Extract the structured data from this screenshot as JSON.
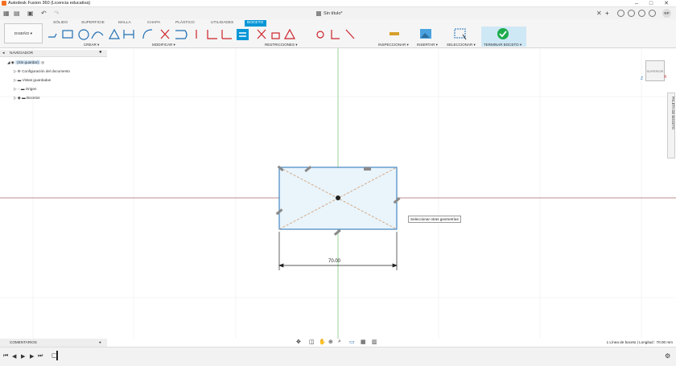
{
  "window": {
    "title": "Autodesk Fusion 360 (Licencia educativa)",
    "minimize": "–",
    "maximize": "□",
    "close": "✕"
  },
  "document": {
    "tab_title": "Sin título*"
  },
  "user": {
    "initials": "RP"
  },
  "ribbon": {
    "workspace": "DISEÑO ▾",
    "tabs": [
      "SÓLIDO",
      "SUPERFICIE",
      "MALLA",
      "CHAPA",
      "PLÁSTICO",
      "UTILIDADES",
      "BOCETO"
    ],
    "active_tab": "BOCETO",
    "groups": {
      "crear": "CREAR ▾",
      "modificar": "MODIFICAR ▾",
      "restricciones": "RESTRICCIONES ▾",
      "inspeccionar": "INSPECCIONAR ▾",
      "insertar": "INSERTAR ▾",
      "seleccionar": "SELECCIONAR ▾",
      "terminar": "TERMINAR BOCETO ▾"
    }
  },
  "navigator": {
    "header": "NAVEGADOR",
    "root": "(Sin guardar)",
    "items": [
      "Configuración del documento",
      "Vistas guardadas",
      "Origen",
      "Bocetos"
    ]
  },
  "comments": {
    "label": "COMENTARIOS"
  },
  "viewcube": {
    "face": "SUPERIOR",
    "axis_z": "Z",
    "axis_x": "X"
  },
  "palette": {
    "label": "PALETA DE BOCETO"
  },
  "canvas": {
    "tooltip": "Seleccionar otras geometrías",
    "dimension": "70.00"
  },
  "status": {
    "text": "1 Línea de boceto | Longitud : 70.00 mm"
  },
  "colors": {
    "accent": "#0696d7",
    "sketch_line": "#1f6fb5",
    "fill": "#e9f4fb",
    "finish": "#1cac4b"
  }
}
